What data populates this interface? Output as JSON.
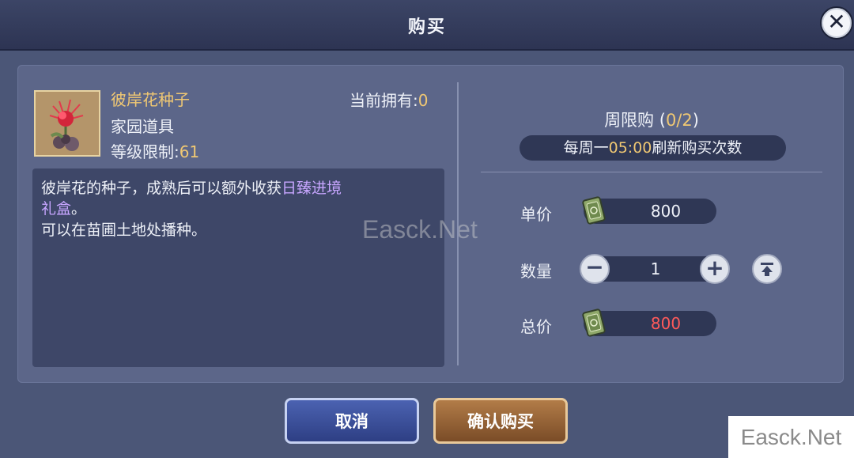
{
  "dialog": {
    "title": "购买"
  },
  "close": {
    "icon": "close-icon"
  },
  "item": {
    "name": "彼岸花种子",
    "type": "家园道具",
    "level_label": "等级限制:",
    "level_value": "61",
    "owned_label": "当前拥有:",
    "owned_value": "0",
    "icon": "red-spider-lily-icon"
  },
  "description": {
    "line1_normal": "彼岸花的种子，成熟后可以额外收获",
    "line1_highlight": "日臻进境",
    "line2_highlight": "礼盒",
    "line2_normal": "。",
    "line3": "可以在苗圃土地处播种。"
  },
  "purchase": {
    "weekly_label": "周限购 (",
    "weekly_count": "0/2",
    "weekly_close": ")",
    "refresh_pre": "每周一",
    "refresh_time": "05:00",
    "refresh_post": "刷新购买次数",
    "unit_price_label": "单价",
    "unit_price": "800",
    "quantity_label": "数量",
    "quantity": "1",
    "total_label": "总价",
    "total_price": "800",
    "currency_icon": "banknote-icon"
  },
  "buttons": {
    "cancel": "取消",
    "confirm": "确认购买"
  },
  "watermarks": {
    "center": "Easck.Net",
    "corner": "Easck.Net"
  },
  "colors": {
    "gold": "#f0c873",
    "purple_link": "#c7a6ff",
    "total_red": "#ff5a5a"
  }
}
